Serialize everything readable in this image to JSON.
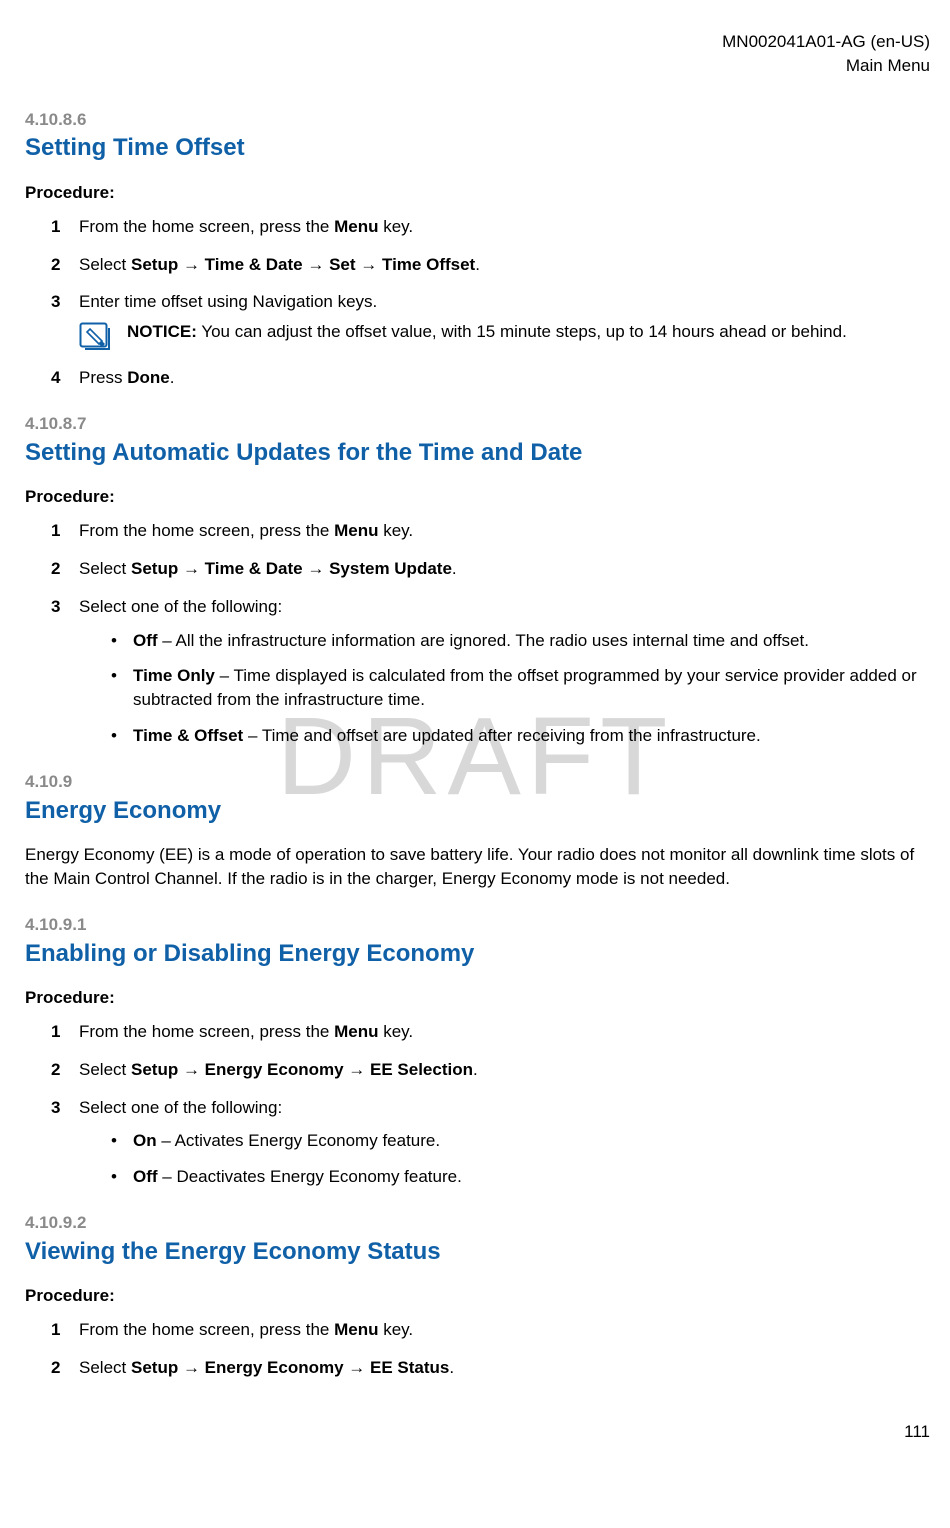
{
  "header": {
    "doc_id": "MN002041A01-AG (en-US)",
    "breadcrumb": "Main Menu"
  },
  "watermark": "DRAFT",
  "page_number": "111",
  "notice_label": "NOTICE:",
  "sections": [
    {
      "num": "4.10.8.6",
      "title": "Setting Time Offset",
      "procedure_label": "Procedure:",
      "steps": [
        {
          "n": "1",
          "parts": [
            "From the home screen, press the ",
            "Menu",
            " key."
          ]
        },
        {
          "n": "2",
          "parts": [
            "Select ",
            "Setup",
            " → ",
            "Time & Date",
            " → ",
            "Set",
            " → ",
            "Time Offset",
            "."
          ]
        },
        {
          "n": "3",
          "parts": [
            "Enter time offset using Navigation keys."
          ],
          "notice": "You can adjust the offset value, with 15 minute steps, up to 14 hours ahead or behind."
        },
        {
          "n": "4",
          "parts": [
            "Press ",
            "Done",
            "."
          ]
        }
      ]
    },
    {
      "num": "4.10.8.7",
      "title": "Setting Automatic Updates for the Time and Date",
      "procedure_label": "Procedure:",
      "steps": [
        {
          "n": "1",
          "parts": [
            "From the home screen, press the ",
            "Menu",
            " key."
          ]
        },
        {
          "n": "2",
          "parts": [
            "Select ",
            "Setup",
            " → ",
            "Time & Date",
            " → ",
            "System Update",
            "."
          ]
        },
        {
          "n": "3",
          "parts": [
            "Select one of the following:"
          ],
          "bullets": [
            {
              "lead": "Off",
              "rest": " – All the infrastructure information are ignored. The radio uses internal time and offset."
            },
            {
              "lead": "Time Only",
              "rest": " – Time displayed is calculated from the offset programmed by your service provider added or subtracted from the infrastructure time."
            },
            {
              "lead": "Time & Offset",
              "rest": " – Time and offset are updated after receiving from the infrastructure."
            }
          ]
        }
      ]
    },
    {
      "num": "4.10.9",
      "title": "Energy Economy",
      "body": "Energy Economy (EE) is a mode of operation to save battery life. Your radio does not monitor all downlink time slots of the Main Control Channel. If the radio is in the charger, Energy Economy mode is not needed."
    },
    {
      "num": "4.10.9.1",
      "title": "Enabling or Disabling Energy Economy",
      "procedure_label": "Procedure:",
      "steps": [
        {
          "n": "1",
          "parts": [
            "From the home screen, press the ",
            "Menu",
            " key."
          ]
        },
        {
          "n": "2",
          "parts": [
            "Select ",
            "Setup",
            " → ",
            "Energy Economy",
            " → ",
            "EE Selection",
            "."
          ]
        },
        {
          "n": "3",
          "parts": [
            "Select one of the following:"
          ],
          "bullets": [
            {
              "lead": "On",
              "rest": " – Activates Energy Economy feature."
            },
            {
              "lead": "Off",
              "rest": " – Deactivates Energy Economy feature."
            }
          ]
        }
      ]
    },
    {
      "num": "4.10.9.2",
      "title": "Viewing the Energy Economy Status",
      "procedure_label": "Procedure:",
      "steps": [
        {
          "n": "1",
          "parts": [
            "From the home screen, press the ",
            "Menu",
            " key."
          ]
        },
        {
          "n": "2",
          "parts": [
            "Select ",
            "Setup",
            " → ",
            "Energy Economy",
            " → ",
            "EE Status",
            "."
          ]
        }
      ]
    }
  ]
}
